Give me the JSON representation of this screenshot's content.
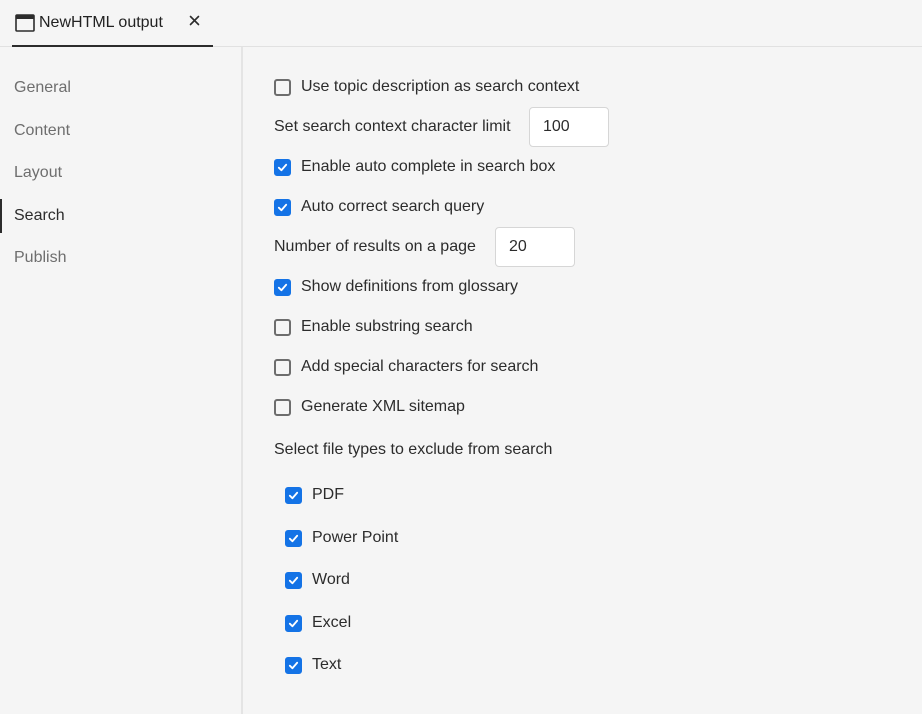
{
  "tab": {
    "title": "NewHTML output",
    "icon": "window-icon",
    "close_icon": "close-icon"
  },
  "sidebar": {
    "items": [
      {
        "label": "General",
        "active": false
      },
      {
        "label": "Content",
        "active": false
      },
      {
        "label": "Layout",
        "active": false
      },
      {
        "label": "Search",
        "active": true
      },
      {
        "label": "Publish",
        "active": false
      }
    ]
  },
  "search": {
    "use_topic_description": {
      "label": "Use topic description as search context",
      "checked": false
    },
    "context_limit": {
      "label": "Set search context character limit",
      "value": "100"
    },
    "auto_complete": {
      "label": "Enable auto complete in search box",
      "checked": true
    },
    "auto_correct": {
      "label": "Auto correct search query",
      "checked": true
    },
    "results_per_page": {
      "label": "Number of results on a page",
      "value": "20"
    },
    "show_definitions": {
      "label": "Show definitions from glossary",
      "checked": true
    },
    "substring_search": {
      "label": "Enable substring search",
      "checked": false
    },
    "special_chars": {
      "label": "Add special characters for search",
      "checked": false
    },
    "xml_sitemap": {
      "label": "Generate XML sitemap",
      "checked": false
    },
    "exclude_heading": "Select file types to exclude from search",
    "file_types": [
      {
        "label": "PDF",
        "checked": true
      },
      {
        "label": "Power Point",
        "checked": true
      },
      {
        "label": "Word",
        "checked": true
      },
      {
        "label": "Excel",
        "checked": true
      },
      {
        "label": "Text",
        "checked": true
      }
    ]
  },
  "colors": {
    "accent": "#1473e6",
    "background": "#f5f5f5",
    "text": "#2c2c2c",
    "muted": "#6e6e6e"
  }
}
